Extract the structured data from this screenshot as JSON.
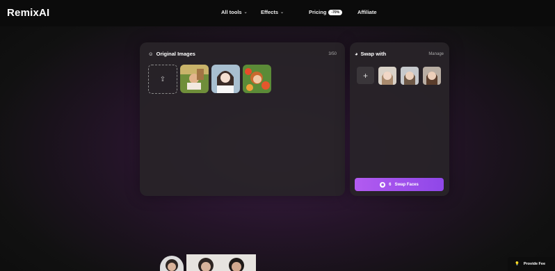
{
  "header": {
    "logo": "RemixAI",
    "nav": [
      {
        "label": "All tools"
      },
      {
        "label": "Effects"
      },
      {
        "label": "Pricing",
        "badge": "-70%"
      },
      {
        "label": "Affiliate"
      }
    ]
  },
  "original_panel": {
    "title": "Original Images",
    "count": "3/50",
    "thumbnails": [
      "park-photo",
      "woman-portrait",
      "flower-girl-photo"
    ]
  },
  "swap_panel": {
    "title": "Swap with",
    "manage_label": "Manage",
    "add_label": "+",
    "faces": [
      "face-1",
      "face-2",
      "face-3"
    ],
    "swap_button": {
      "credits": "6",
      "label": "Swap Faces"
    }
  },
  "feedback": {
    "label": "Provide Fee"
  },
  "colors": {
    "accent": "#a653ee",
    "panel": "#282428",
    "background": "#0c0c0c"
  }
}
